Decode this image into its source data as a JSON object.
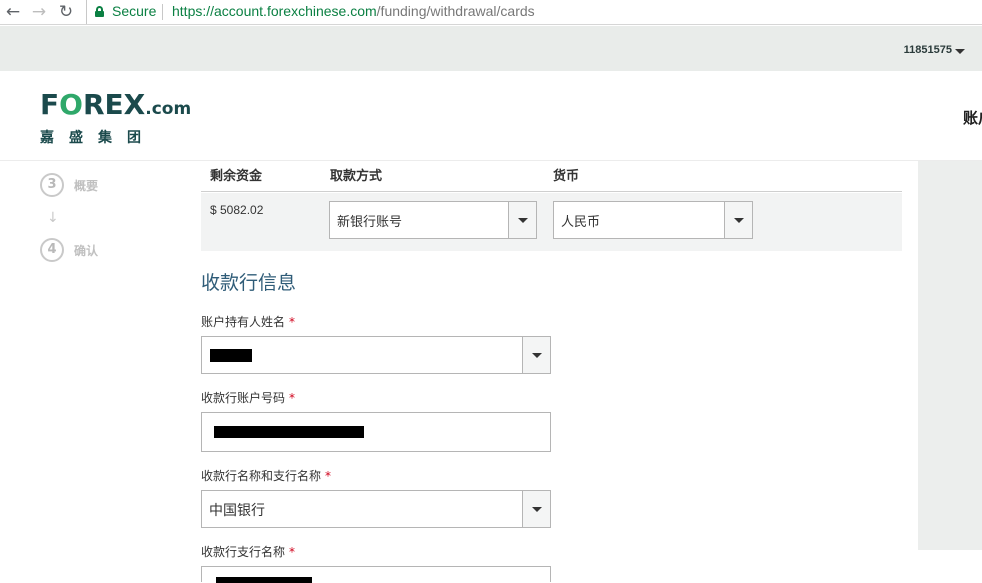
{
  "browser": {
    "back_icon": "arrow-left-icon",
    "forward_icon": "arrow-right-icon",
    "reload_icon": "reload-icon",
    "secure_label": "Secure",
    "url_origin": "https://account.forexchinese.com",
    "url_path": "/funding/withdrawal/cards",
    "secure_color": "#0b8043"
  },
  "account": {
    "id": "11851575"
  },
  "header": {
    "logo_main_pre": "F",
    "logo_main_o": "O",
    "logo_main_post": "REX",
    "logo_com": ".com",
    "logo_sub": "嘉盛集团",
    "right_label": "账户"
  },
  "steps": [
    {
      "number": "3",
      "label": "概要"
    },
    {
      "number": "4",
      "label": "确认"
    }
  ],
  "summary": {
    "headers": [
      "剩余资金",
      "取款方式",
      "货币"
    ],
    "balance": "$ 5082.02",
    "method_selected": "新银行账号",
    "currency_selected": "人民币"
  },
  "bank_info": {
    "title": "收款行信息",
    "holder_label": "账户持有人姓名",
    "account_label": "收款行账户号码",
    "bank_label": "收款行名称和支行名称",
    "bank_selected": "中国银行",
    "branch_label": "收款行支行名称",
    "required_mark": "*"
  },
  "colors": {
    "brand_dark": "#1b4a4c",
    "brand_green": "#2fa86a",
    "title_blue": "#2f5c78",
    "required_red": "#d0021b"
  }
}
